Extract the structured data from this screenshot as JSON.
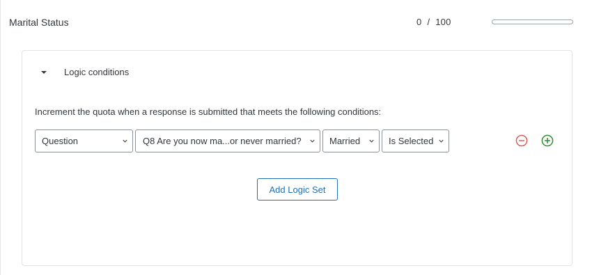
{
  "quota": {
    "name": "Marital Status",
    "current": "0",
    "separator": "/",
    "total": "100",
    "progress_fraction": 0.0
  },
  "logic": {
    "heading": "Logic conditions",
    "expanded": true,
    "description": "Increment the quota when a response is submitted that meets the following conditions:",
    "condition": {
      "type_select": "Question",
      "question_select": "Q8 Are you now ma...or never married?",
      "choice_select": "Married",
      "operator_select": "Is Selected"
    },
    "add_logic_set_label": "Add Logic Set"
  },
  "icons": {
    "collapse": "caret-down-icon",
    "dropdown": "chevron-down-icon",
    "remove": "minus-circle-icon",
    "add": "plus-circle-icon"
  },
  "colors": {
    "remove_red": "#d9534f",
    "add_green": "#2e8b2e",
    "accent_blue": "#1e6fb5",
    "text": "#32363a",
    "panel_border": "#e1e3e6"
  }
}
